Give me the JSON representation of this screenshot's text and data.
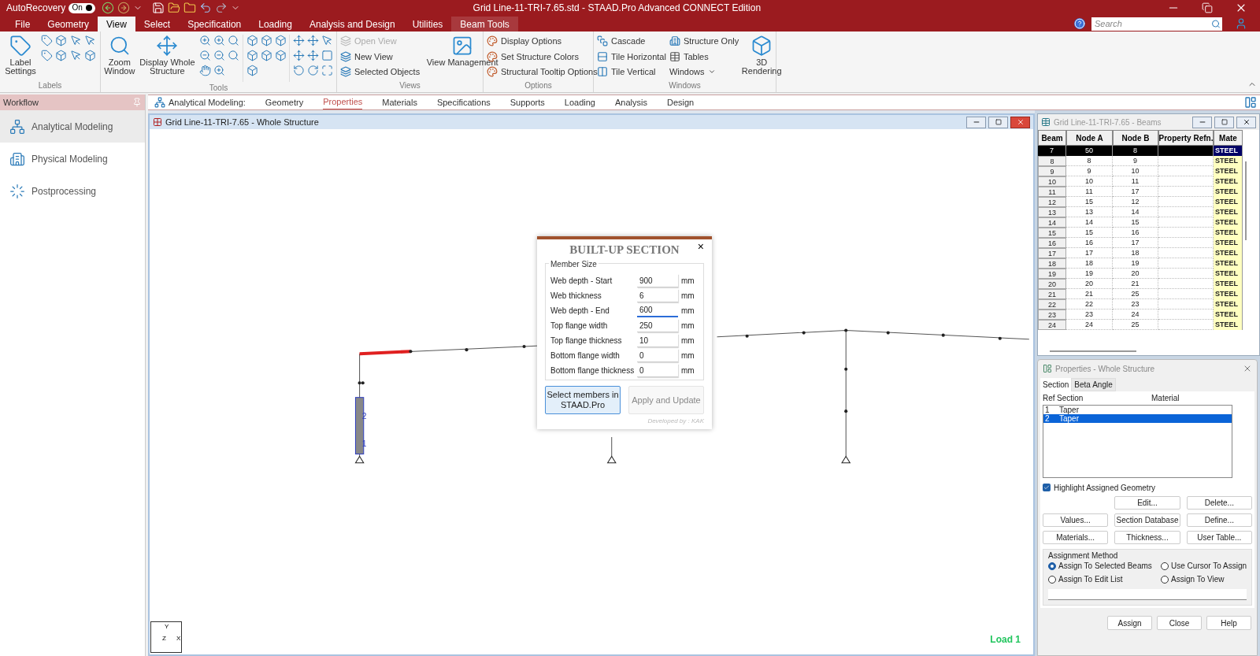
{
  "title_bar": {
    "autorecovery": "AutoRecovery",
    "toggle": {
      "label": "On",
      "on": true
    },
    "title": "Grid Line-11-TRI-7.65.std - STAAD.Pro Advanced CONNECT Edition"
  },
  "menu_tabs": [
    {
      "label": "File",
      "selected": false,
      "kind": "normal"
    },
    {
      "label": "Geometry",
      "selected": false,
      "kind": "normal"
    },
    {
      "label": "View",
      "selected": true,
      "kind": "normal"
    },
    {
      "label": "Select",
      "selected": false,
      "kind": "normal"
    },
    {
      "label": "Specification",
      "selected": false,
      "kind": "normal"
    },
    {
      "label": "Loading",
      "selected": false,
      "kind": "normal"
    },
    {
      "label": "Analysis and Design",
      "selected": false,
      "kind": "normal"
    },
    {
      "label": "Utilities",
      "selected": false,
      "kind": "normal"
    },
    {
      "label": "Beam Tools",
      "selected": false,
      "kind": "contextual"
    }
  ],
  "search": {
    "placeholder": "Search"
  },
  "ribbon": {
    "labels_group": {
      "title": "Labels",
      "button": "Label Settings"
    },
    "tools_group": {
      "title": "Tools",
      "buttons": [
        "Zoom Window",
        "Display Whole Structure"
      ]
    },
    "views_group": {
      "title": "Views",
      "items": [
        {
          "label": "Open View",
          "disabled": true
        },
        {
          "label": "New View",
          "disabled": false
        },
        {
          "label": "Selected Objects",
          "disabled": false
        }
      ],
      "button": "View Management"
    },
    "options_group": {
      "title": "Options",
      "items": [
        "Display Options",
        "Set Structure Colors",
        "Structural Tooltip Options"
      ]
    },
    "windows_group": {
      "title": "Windows",
      "items": [
        "Cascade",
        "Tile Horizontal",
        "Tile Vertical"
      ],
      "items_2": [
        "Structure Only",
        "Tables",
        "Windows"
      ],
      "button": "3D Rendering"
    }
  },
  "workflow": {
    "title": "Workflow",
    "items": [
      {
        "label": "Analytical Modeling",
        "selected": true
      },
      {
        "label": "Physical Modeling",
        "selected": false
      },
      {
        "label": "Postprocessing",
        "selected": false
      }
    ]
  },
  "page_tabs": {
    "lead": "Analytical Modeling:",
    "tabs": [
      {
        "label": "Geometry",
        "selected": false
      },
      {
        "label": "Properties",
        "selected": true
      },
      {
        "label": "Materials",
        "selected": false
      },
      {
        "label": "Specifications",
        "selected": false
      },
      {
        "label": "Supports",
        "selected": false
      },
      {
        "label": "Loading",
        "selected": false
      },
      {
        "label": "Analysis",
        "selected": false
      },
      {
        "label": "Design",
        "selected": false
      }
    ]
  },
  "view_window": {
    "title": "Grid Line-11-TRI-7.65 - Whole Structure",
    "member_labels": [
      "2",
      "1"
    ],
    "axes": [
      "Y",
      "Z",
      "X"
    ],
    "load_label": "Load 1"
  },
  "dialog": {
    "title": "BUILT-UP SECTION",
    "close": "×",
    "group": "Member Size",
    "fields": [
      {
        "label": "Web depth - Start",
        "value": "900",
        "unit": "mm",
        "focused": false
      },
      {
        "label": "Web thickness",
        "value": "6",
        "unit": "mm",
        "focused": false
      },
      {
        "label": "Web depth - End",
        "value": "600",
        "unit": "mm",
        "focused": true
      },
      {
        "label": "Top flange width",
        "value": "250",
        "unit": "mm",
        "focused": false
      },
      {
        "label": "Top flange thickness",
        "value": "10",
        "unit": "mm",
        "focused": false
      },
      {
        "label": "Bottom flange width",
        "value": "0",
        "unit": "mm",
        "focused": false
      },
      {
        "label": "Bottom flange thickness",
        "value": "0",
        "unit": "mm",
        "focused": false
      }
    ],
    "buttons": [
      {
        "label": "Select members in STAAD.Pro",
        "highlighted": true
      },
      {
        "label": "Apply and Update",
        "highlighted": false
      }
    ],
    "footer": "Developed by : KAK"
  },
  "beams_table": {
    "title": "Grid Line-11-TRI-7.65 - Beams",
    "columns": [
      "Beam",
      "Node A",
      "Node B",
      "Property Refn.",
      "Mate"
    ],
    "rows": [
      {
        "cells": [
          "7",
          "50",
          "8",
          "",
          "STEEL"
        ],
        "selected": true
      },
      {
        "cells": [
          "8",
          "8",
          "9",
          "",
          "STEEL"
        ],
        "selected": false
      },
      {
        "cells": [
          "9",
          "9",
          "10",
          "",
          "STEEL"
        ],
        "selected": false
      },
      {
        "cells": [
          "10",
          "10",
          "11",
          "",
          "STEEL"
        ],
        "selected": false
      },
      {
        "cells": [
          "11",
          "11",
          "17",
          "",
          "STEEL"
        ],
        "selected": false
      },
      {
        "cells": [
          "12",
          "15",
          "12",
          "",
          "STEEL"
        ],
        "selected": false
      },
      {
        "cells": [
          "13",
          "13",
          "14",
          "",
          "STEEL"
        ],
        "selected": false
      },
      {
        "cells": [
          "14",
          "14",
          "15",
          "",
          "STEEL"
        ],
        "selected": false
      },
      {
        "cells": [
          "15",
          "15",
          "16",
          "",
          "STEEL"
        ],
        "selected": false
      },
      {
        "cells": [
          "16",
          "16",
          "17",
          "",
          "STEEL"
        ],
        "selected": false
      },
      {
        "cells": [
          "17",
          "17",
          "18",
          "",
          "STEEL"
        ],
        "selected": false
      },
      {
        "cells": [
          "18",
          "18",
          "19",
          "",
          "STEEL"
        ],
        "selected": false
      },
      {
        "cells": [
          "19",
          "19",
          "20",
          "",
          "STEEL"
        ],
        "selected": false
      },
      {
        "cells": [
          "20",
          "20",
          "21",
          "",
          "STEEL"
        ],
        "selected": false
      },
      {
        "cells": [
          "21",
          "21",
          "25",
          "",
          "STEEL"
        ],
        "selected": false
      },
      {
        "cells": [
          "22",
          "22",
          "23",
          "",
          "STEEL"
        ],
        "selected": false
      },
      {
        "cells": [
          "23",
          "23",
          "24",
          "",
          "STEEL"
        ],
        "selected": false
      },
      {
        "cells": [
          "24",
          "24",
          "25",
          "",
          "STEEL"
        ],
        "selected": false
      }
    ]
  },
  "properties": {
    "title": "Properties - Whole Structure",
    "tabs": [
      {
        "label": "Section",
        "selected": true
      },
      {
        "label": "Beta Angle",
        "selected": false
      }
    ],
    "columns": [
      "Ref",
      "Section",
      "Material"
    ],
    "rows": [
      {
        "ref": "1",
        "section": "Taper",
        "selected": false
      },
      {
        "ref": "2",
        "section": "Taper",
        "selected": true
      }
    ],
    "highlight": {
      "label": "Highlight Assigned Geometry",
      "checked": true
    },
    "buttons": [
      "Edit...",
      "Delete...",
      "Values...",
      "Section Database",
      "Define...",
      "Materials...",
      "Thickness...",
      "User Table..."
    ],
    "assignment": {
      "title": "Assignment Method",
      "options": [
        {
          "label": "Assign To Selected Beams",
          "selected": true
        },
        {
          "label": "Use Cursor To Assign",
          "selected": false
        },
        {
          "label": "Assign To Edit List",
          "selected": false
        },
        {
          "label": "Assign To View",
          "selected": false
        }
      ]
    },
    "footer_buttons": [
      "Assign",
      "Close",
      "Help"
    ]
  }
}
